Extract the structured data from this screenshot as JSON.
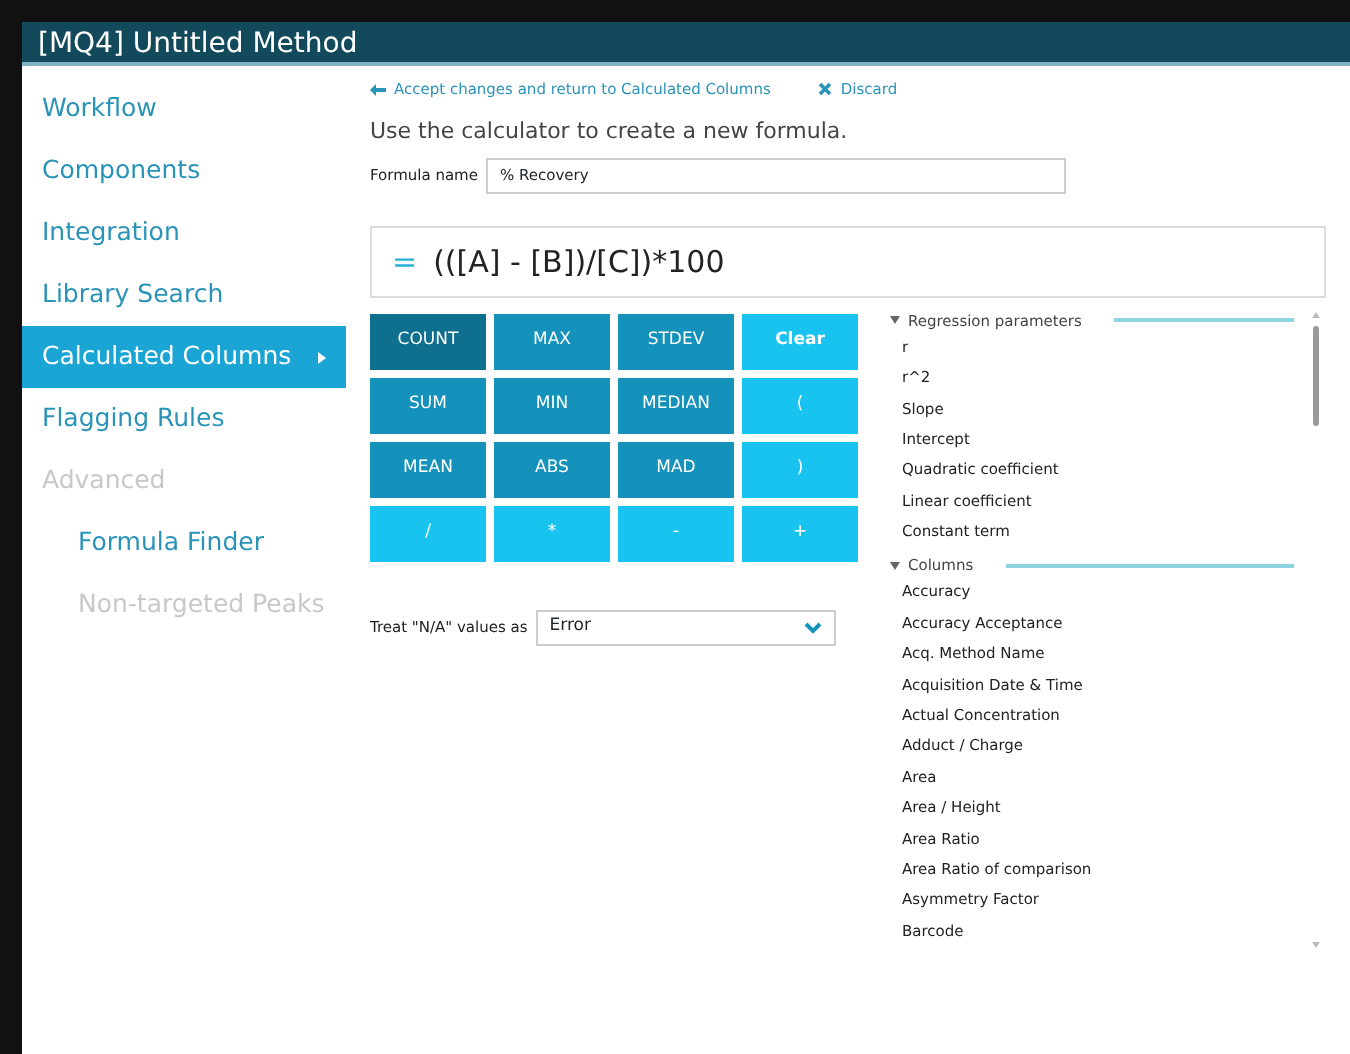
{
  "window": {
    "title": "[MQ4] Untitled Method"
  },
  "sidebar": {
    "items": [
      {
        "label": "Workflow",
        "selected": false,
        "disabled": false
      },
      {
        "label": "Components",
        "selected": false,
        "disabled": false
      },
      {
        "label": "Integration",
        "selected": false,
        "disabled": false
      },
      {
        "label": "Library Search",
        "selected": false,
        "disabled": false
      },
      {
        "label": "Calculated Columns",
        "selected": true,
        "disabled": false
      },
      {
        "label": "Flagging Rules",
        "selected": false,
        "disabled": false
      },
      {
        "label": "Advanced",
        "selected": false,
        "disabled": true,
        "children": [
          {
            "label": "Formula Finder",
            "selected": false,
            "disabled": false
          },
          {
            "label": "Non-targeted Peaks",
            "selected": false,
            "disabled": true
          }
        ]
      }
    ]
  },
  "toolbar": {
    "accept": "Accept changes and return to Calculated Columns",
    "discard": "Discard"
  },
  "instruction": "Use the calculator to create a new formula.",
  "formula_name": {
    "label": "Formula name",
    "value": "% Recovery"
  },
  "formula": {
    "prefix": "=",
    "expression": "(([A] - [B])/[C])*100"
  },
  "keypad": [
    {
      "label": "COUNT",
      "kind": "function",
      "hovered": true
    },
    {
      "label": "MAX",
      "kind": "function",
      "hovered": false
    },
    {
      "label": "STDEV",
      "kind": "function",
      "hovered": false
    },
    {
      "label": "Clear",
      "kind": "clear",
      "hovered": false
    },
    {
      "label": "SUM",
      "kind": "function",
      "hovered": false
    },
    {
      "label": "MIN",
      "kind": "function",
      "hovered": false
    },
    {
      "label": "MEDIAN",
      "kind": "function",
      "hovered": false
    },
    {
      "label": "(",
      "kind": "operator",
      "hovered": false
    },
    {
      "label": "MEAN",
      "kind": "function",
      "hovered": false
    },
    {
      "label": "ABS",
      "kind": "function",
      "hovered": false
    },
    {
      "label": "MAD",
      "kind": "function",
      "hovered": false
    },
    {
      "label": ")",
      "kind": "operator",
      "hovered": false
    },
    {
      "label": "/",
      "kind": "operator",
      "hovered": false
    },
    {
      "label": "*",
      "kind": "operator",
      "hovered": false
    },
    {
      "label": "-",
      "kind": "operator",
      "hovered": false
    },
    {
      "label": "+",
      "kind": "operator",
      "hovered": false
    }
  ],
  "na_option": {
    "label": "Treat \"N/A\" values as",
    "value": "Error"
  },
  "fields": [
    {
      "group": "Regression parameters",
      "expanded": true,
      "items": [
        "r",
        "r^2",
        "Slope",
        "Intercept",
        "Quadratic coefficient",
        "Linear coefficient",
        "Constant term"
      ]
    },
    {
      "group": "Columns",
      "expanded": true,
      "items": [
        "Accuracy",
        "Accuracy Acceptance",
        "Acq. Method Name",
        "Acquisition Date & Time",
        "Actual Concentration",
        "Adduct / Charge",
        "Area",
        "Area / Height",
        "Area Ratio",
        "Area Ratio of comparison",
        "Asymmetry Factor",
        "Barcode"
      ]
    }
  ]
}
